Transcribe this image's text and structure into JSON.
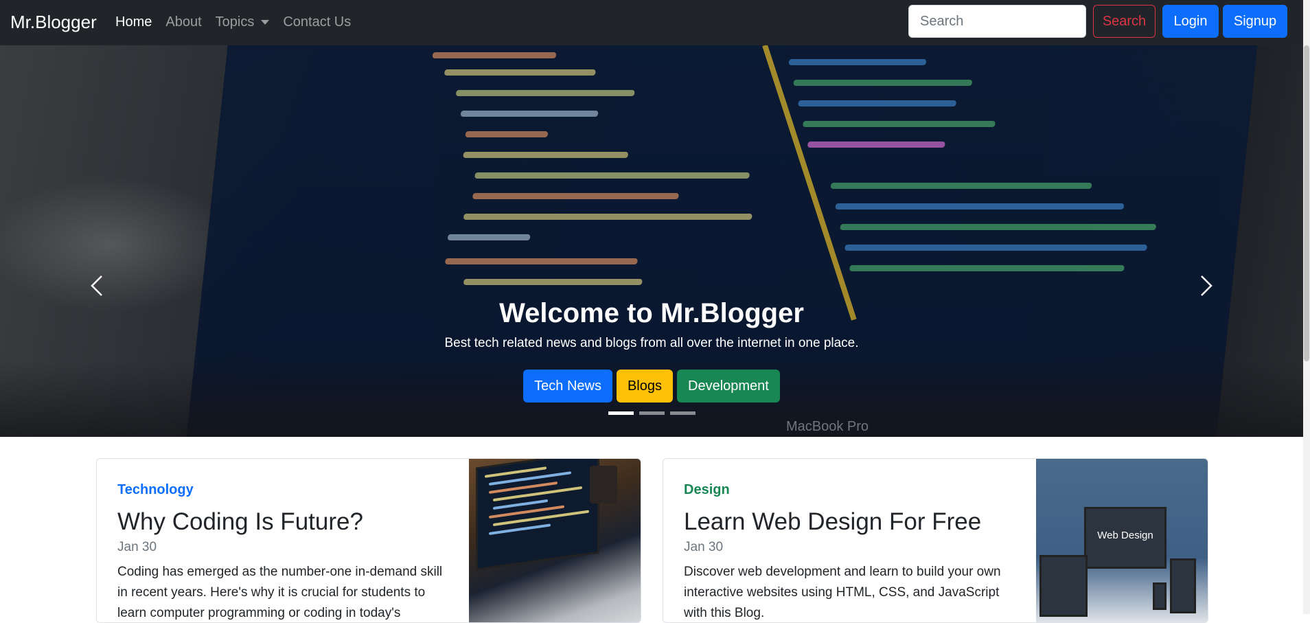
{
  "navbar": {
    "brand": "Mr.Blogger",
    "links": [
      {
        "label": "Home",
        "active": true
      },
      {
        "label": "About",
        "active": false
      },
      {
        "label": "Topics",
        "active": false,
        "dropdown": true
      },
      {
        "label": "Contact Us",
        "active": false
      }
    ],
    "search_placeholder": "Search",
    "search_button": "Search",
    "login_button": "Login",
    "signup_button": "Signup"
  },
  "hero": {
    "title": "Welcome to Mr.Blogger",
    "subtitle": "Best tech related news and blogs from all over the internet in one place.",
    "buttons": [
      "Tech News",
      "Blogs",
      "Development"
    ],
    "watermark": "MacBook Pro",
    "slides": 3,
    "active_slide": 1
  },
  "cards": [
    {
      "category": "Technology",
      "title": "Why Coding Is Future?",
      "date": "Jan 30",
      "text": "Coding has emerged as the number-one in-demand skill in recent years. Here's why it is crucial for students to learn computer programming or coding in today's",
      "image_icon": "laptop-code-image"
    },
    {
      "category": "Design",
      "title": "Learn Web Design For Free",
      "date": "Jan 30",
      "text": "Discover web development and learn to build your own interactive websites using HTML, CSS, and JavaScript with this Blog.",
      "image_icon": "web-design-devices-image",
      "image_label": "Web Design"
    }
  ],
  "colors": {
    "navbar_bg": "#212529",
    "primary": "#0d6efd",
    "danger": "#dc3545",
    "warning": "#ffc107",
    "success": "#198754"
  }
}
